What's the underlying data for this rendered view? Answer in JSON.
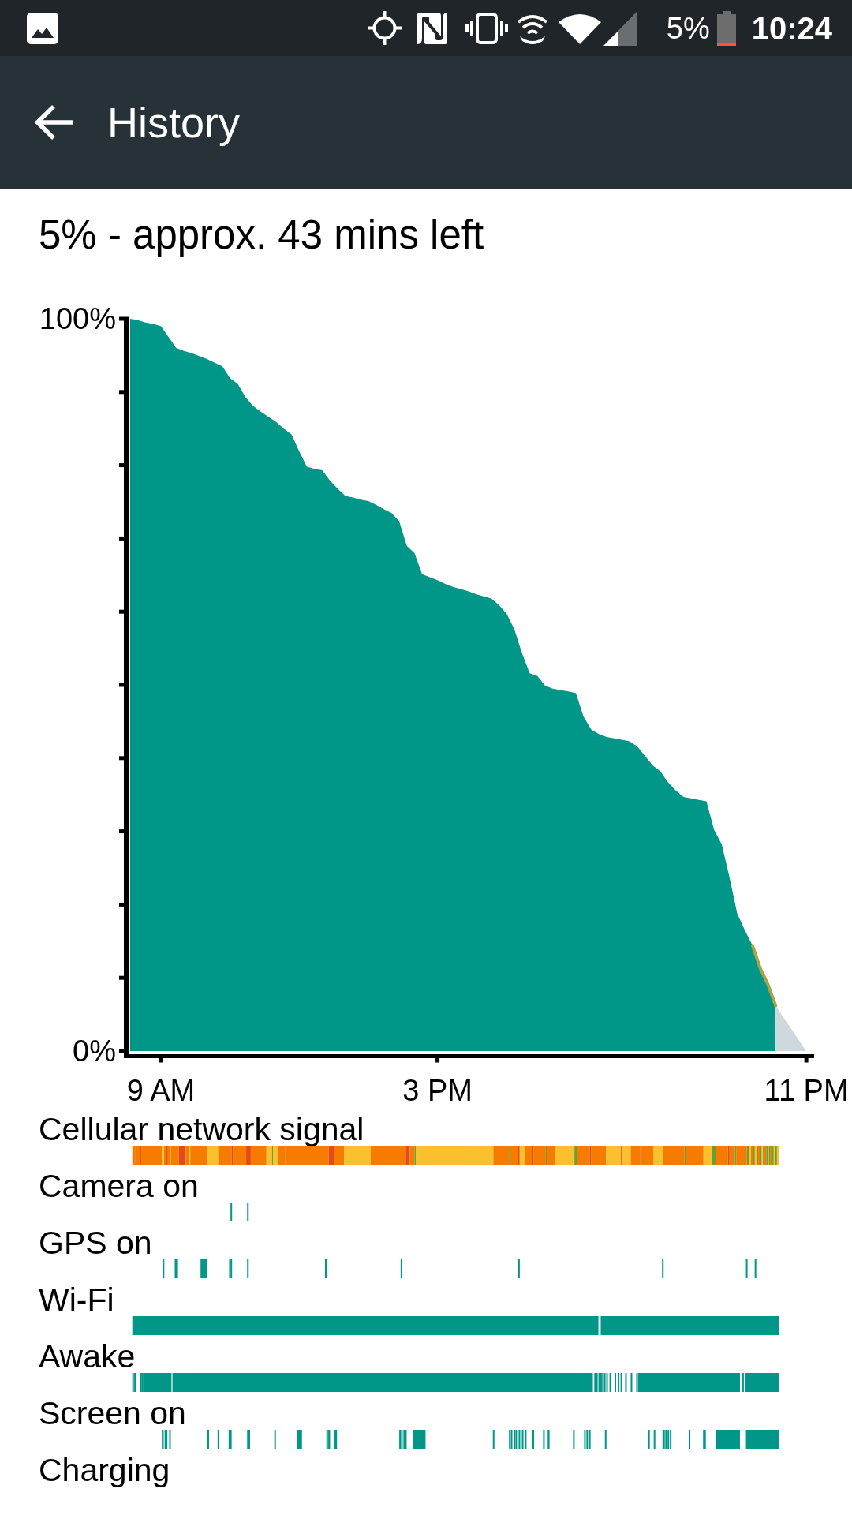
{
  "status_bar": {
    "battery_percent": "5%",
    "time": "10:24"
  },
  "app_bar": {
    "title": "History"
  },
  "battery_estimate": "5% - approx. 43 mins left",
  "battery_chart": {
    "chart_data": {
      "type": "area",
      "categories": [
        null,
        null,
        null,
        null,
        "9 AM",
        null,
        null,
        null,
        null,
        null,
        null,
        null,
        null,
        null,
        null,
        null,
        null,
        null,
        null,
        null,
        null,
        null,
        null,
        null,
        null,
        null,
        null,
        null,
        null,
        null,
        null,
        null,
        null,
        null,
        null,
        null,
        null,
        null,
        null,
        null,
        "3 PM",
        null,
        null,
        null,
        null,
        null,
        null,
        null,
        null,
        null,
        null,
        null,
        null,
        null,
        null,
        null,
        null,
        null,
        null,
        null,
        null,
        null,
        null,
        null,
        null,
        null,
        null,
        null,
        null,
        null,
        null,
        null,
        null,
        null,
        null,
        null,
        null,
        null,
        null,
        null,
        null,
        null,
        null,
        null,
        null,
        null,
        null,
        null,
        "11 PM"
      ],
      "series": [
        {
          "color": "#009688",
          "values": [
            100,
            99.8,
            99.5,
            99.3,
            99.0,
            97.5,
            96.0,
            95.6,
            95.3,
            94.9,
            94.5,
            94.0,
            93.5,
            91.9,
            91.1,
            89.3,
            88.1,
            87.3,
            86.6,
            85.9,
            85.0,
            84.2,
            81.9,
            79.8,
            79.5,
            79.3,
            77.9,
            76.8,
            75.8,
            75.6,
            75.3,
            75.1,
            74.6,
            74.0,
            73.5,
            72.4,
            69.0,
            68.0,
            65.1,
            64.7,
            64.3,
            63.8,
            63.4,
            63.1,
            62.8,
            62.4,
            62.1,
            61.8,
            60.9,
            59.7,
            57.6,
            54.3,
            51.6,
            51.2,
            49.9,
            49.5,
            49.3,
            49.1,
            48.9,
            45.7,
            43.9,
            43.3,
            42.9,
            42.7,
            42.5,
            42.3,
            41.6,
            40.3,
            39.0,
            38.2,
            36.7,
            35.6,
            34.7,
            34.5,
            34.3,
            34.1,
            30.2,
            28.2,
            23.7,
            18.8,
            16.5,
            14.4,
            11.3,
            9.1,
            6.2,
            null,
            null,
            null,
            null
          ]
        },
        {
          "color": "#cfd8dc",
          "values": [
            null,
            null,
            null,
            null,
            null,
            null,
            null,
            null,
            null,
            null,
            null,
            null,
            null,
            null,
            null,
            null,
            null,
            null,
            null,
            null,
            null,
            null,
            null,
            null,
            null,
            null,
            null,
            null,
            null,
            null,
            null,
            null,
            null,
            null,
            null,
            null,
            null,
            null,
            null,
            null,
            null,
            null,
            null,
            null,
            null,
            null,
            null,
            null,
            null,
            null,
            null,
            null,
            null,
            null,
            null,
            null,
            null,
            null,
            null,
            null,
            null,
            null,
            null,
            null,
            null,
            null,
            null,
            null,
            null,
            null,
            null,
            null,
            null,
            null,
            null,
            null,
            null,
            null,
            null,
            null,
            null,
            null,
            null,
            null,
            6.2,
            4.6,
            3.1,
            1.5,
            0
          ]
        }
      ],
      "ylim": [
        0,
        100
      ],
      "yticks": [
        {
          "value": 0,
          "label": "0%"
        },
        {
          "value": 100,
          "label": "100%"
        }
      ]
    }
  },
  "events": [
    {
      "label": "Cellular network signal"
    },
    {
      "label": "Camera on"
    },
    {
      "label": "GPS on"
    },
    {
      "label": "Wi-Fi"
    },
    {
      "label": "Awake"
    },
    {
      "label": "Screen on"
    },
    {
      "label": "Charging"
    }
  ]
}
